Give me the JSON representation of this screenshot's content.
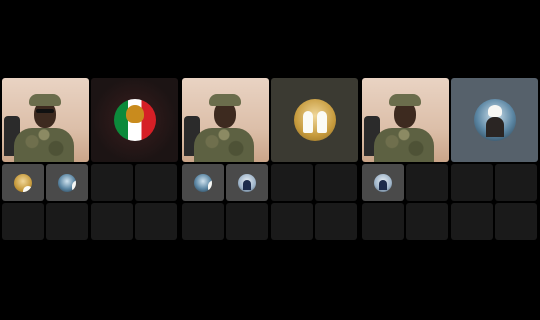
{
  "app": {
    "panels": [
      {
        "main_tiles": [
          {
            "kind": "camera",
            "icon": "participant-video"
          },
          {
            "kind": "avatar",
            "icon": "flag-emblem-avatar",
            "colors": [
              "#0c8a3b",
              "#ffffff",
              "#d61f26"
            ]
          }
        ],
        "small_tiles": [
          {
            "active": true,
            "icon": "gold-avatar"
          },
          {
            "active": true,
            "icon": "blue-avatar"
          },
          {
            "active": false
          },
          {
            "active": false
          },
          {
            "active": false
          },
          {
            "active": false
          },
          {
            "active": false
          },
          {
            "active": false
          }
        ]
      },
      {
        "main_tiles": [
          {
            "kind": "camera",
            "icon": "participant-video"
          },
          {
            "kind": "avatar",
            "icon": "gold-avatar"
          }
        ],
        "small_tiles": [
          {
            "active": true,
            "icon": "blue-avatar"
          },
          {
            "active": true,
            "icon": "suit-avatar"
          },
          {
            "active": false
          },
          {
            "active": false
          },
          {
            "active": false
          },
          {
            "active": false
          },
          {
            "active": false
          },
          {
            "active": false
          }
        ]
      },
      {
        "main_tiles": [
          {
            "kind": "camera",
            "icon": "participant-video"
          },
          {
            "kind": "avatar",
            "icon": "blue-avatar"
          }
        ],
        "small_tiles": [
          {
            "active": true,
            "icon": "suit-avatar"
          },
          {
            "active": false
          },
          {
            "active": false
          },
          {
            "active": false
          },
          {
            "active": false
          },
          {
            "active": false
          },
          {
            "active": false
          },
          {
            "active": false
          }
        ]
      }
    ],
    "colors": {
      "background": "#000000",
      "empty_tile": "#1a1a1a",
      "active_tile": "#4a4a4a"
    }
  }
}
